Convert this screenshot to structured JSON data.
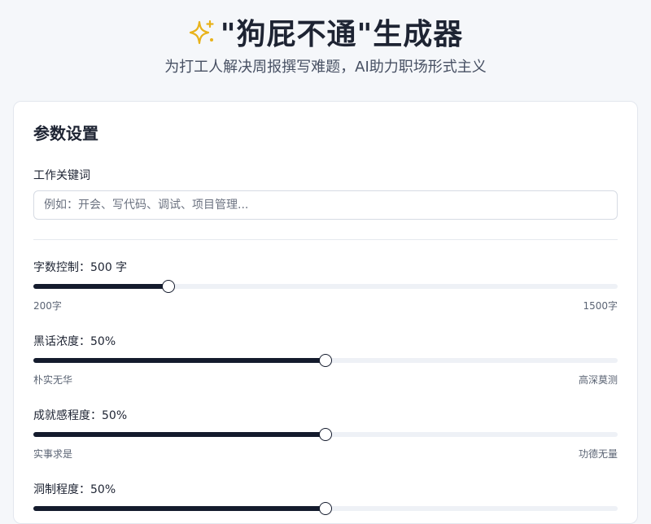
{
  "header": {
    "title": "\"狗屁不通\"生成器",
    "subtitle": "为打工人解决周报撰写难题，AI助力职场形式主义",
    "icon": "sparkle-icon",
    "icon_color": "#e8b21a"
  },
  "card": {
    "title": "参数设置",
    "keyword_label": "工作关键词",
    "keyword_placeholder": "例如：开会、写代码、调试、项目管理...",
    "keyword_value": ""
  },
  "sliders": [
    {
      "label": "字数控制：500 字",
      "min_label": "200字",
      "max_label": "1500字",
      "value": 500,
      "min": 200,
      "max": 1500
    },
    {
      "label": "黑话浓度：50%",
      "min_label": "朴实无华",
      "max_label": "高深莫测",
      "value": 50,
      "min": 0,
      "max": 100
    },
    {
      "label": "成就感程度：50%",
      "min_label": "实事求是",
      "max_label": "功德无量",
      "value": 50,
      "min": 0,
      "max": 100
    },
    {
      "label": "洞制程度：50%",
      "min_label": "",
      "max_label": "",
      "value": 50,
      "min": 0,
      "max": 100
    }
  ],
  "colors": {
    "accent": "#141b2d",
    "track": "#eef1f6",
    "background": "#f5f7fa"
  }
}
